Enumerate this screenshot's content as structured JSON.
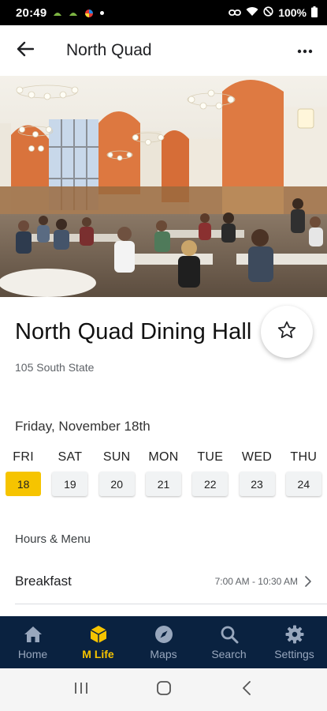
{
  "status_bar": {
    "time": "20:49",
    "battery": "100%"
  },
  "app_bar": {
    "title": "North Quad"
  },
  "hall": {
    "name": "North Quad Dining Hall",
    "address": "105 South State"
  },
  "date_label": "Friday, November 18th",
  "days": [
    {
      "name": "FRI",
      "num": "18",
      "selected": true
    },
    {
      "name": "SAT",
      "num": "19",
      "selected": false
    },
    {
      "name": "SUN",
      "num": "20",
      "selected": false
    },
    {
      "name": "MON",
      "num": "21",
      "selected": false
    },
    {
      "name": "TUE",
      "num": "22",
      "selected": false
    },
    {
      "name": "WED",
      "num": "23",
      "selected": false
    },
    {
      "name": "THU",
      "num": "24",
      "selected": false
    }
  ],
  "hours_label": "Hours & Menu",
  "meals": [
    {
      "name": "Breakfast",
      "time": "7:00 AM - 10:30 AM"
    }
  ],
  "bottom_nav": [
    {
      "label": "Home",
      "icon": "home-icon",
      "active": false
    },
    {
      "label": "M Life",
      "icon": "cube-icon",
      "active": true
    },
    {
      "label": "Maps",
      "icon": "compass-icon",
      "active": false
    },
    {
      "label": "Search",
      "icon": "search-icon",
      "active": false
    },
    {
      "label": "Settings",
      "icon": "gear-icon",
      "active": false
    }
  ],
  "colors": {
    "accent": "#f6c400",
    "nav_background": "#0a2240",
    "nav_inactive": "#98a7bd"
  }
}
